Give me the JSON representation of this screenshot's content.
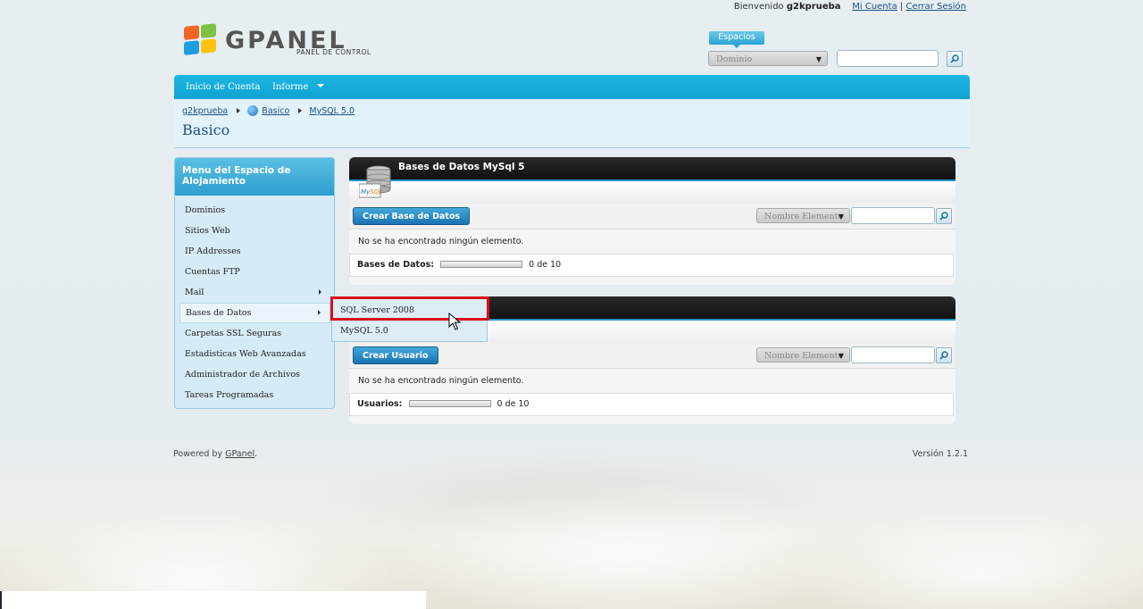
{
  "header": {
    "welcome": "Bienvenido",
    "username": "g2kprueba",
    "my_account": "Mi Cuenta",
    "separator": "|",
    "logout": "Cerrar Sesión"
  },
  "logo": {
    "name": "GPANEL",
    "subtitle": "PANEL DE CONTROL"
  },
  "spaces": {
    "tab_label": "Espacios",
    "select_value": "Dominio",
    "search_value": ""
  },
  "nav": {
    "items": [
      {
        "label": "Inicio de Cuenta"
      },
      {
        "label": "Informe"
      }
    ]
  },
  "breadcrumb": {
    "items": [
      "g2kprueba",
      "Basico",
      "MySQL 5.0"
    ],
    "page_title": "Basico"
  },
  "sidebar": {
    "title": "Menu del Espacio de Alojamiento",
    "items": [
      {
        "label": "Dominios"
      },
      {
        "label": "Sitios Web"
      },
      {
        "label": "IP Addresses"
      },
      {
        "label": "Cuentas FTP"
      },
      {
        "label": "Mail"
      },
      {
        "label": "Bases de Datos"
      },
      {
        "label": "Carpetas SSL Seguras"
      },
      {
        "label": "Estadisticas Web Avanzadas"
      },
      {
        "label": "Administrador de Archivos"
      },
      {
        "label": "Tareas Programadas"
      }
    ]
  },
  "flyout": {
    "items": [
      {
        "label": "SQL Server 2008"
      },
      {
        "label": "MySQL 5.0"
      }
    ]
  },
  "databases_panel": {
    "title": "Bases de Datos MySql 5",
    "create_button": "Crear Base de Datos",
    "filter_select": "Nombre Elemento",
    "filter_value": "",
    "empty_message": "No se ha encontrado ningún elemento.",
    "quota_label": "Bases de Datos:",
    "quota_text": "0 de 10",
    "quota_fraction": 0
  },
  "users_panel": {
    "create_button": "Crear Usuario",
    "filter_select": "Nombre Elemento",
    "filter_value": "",
    "empty_message": "No se ha encontrado ningún elemento.",
    "quota_label": "Usuarios:",
    "quota_text": "0 de 10",
    "quota_fraction": 0
  },
  "footer": {
    "powered_by": "Powered by",
    "powered_link": "GPanel",
    "period": ".",
    "version": "Versión 1.2.1"
  },
  "colors": {
    "accent": "#0ea3d2",
    "highlight_box": "#d8101a",
    "link": "#1a4f85"
  }
}
